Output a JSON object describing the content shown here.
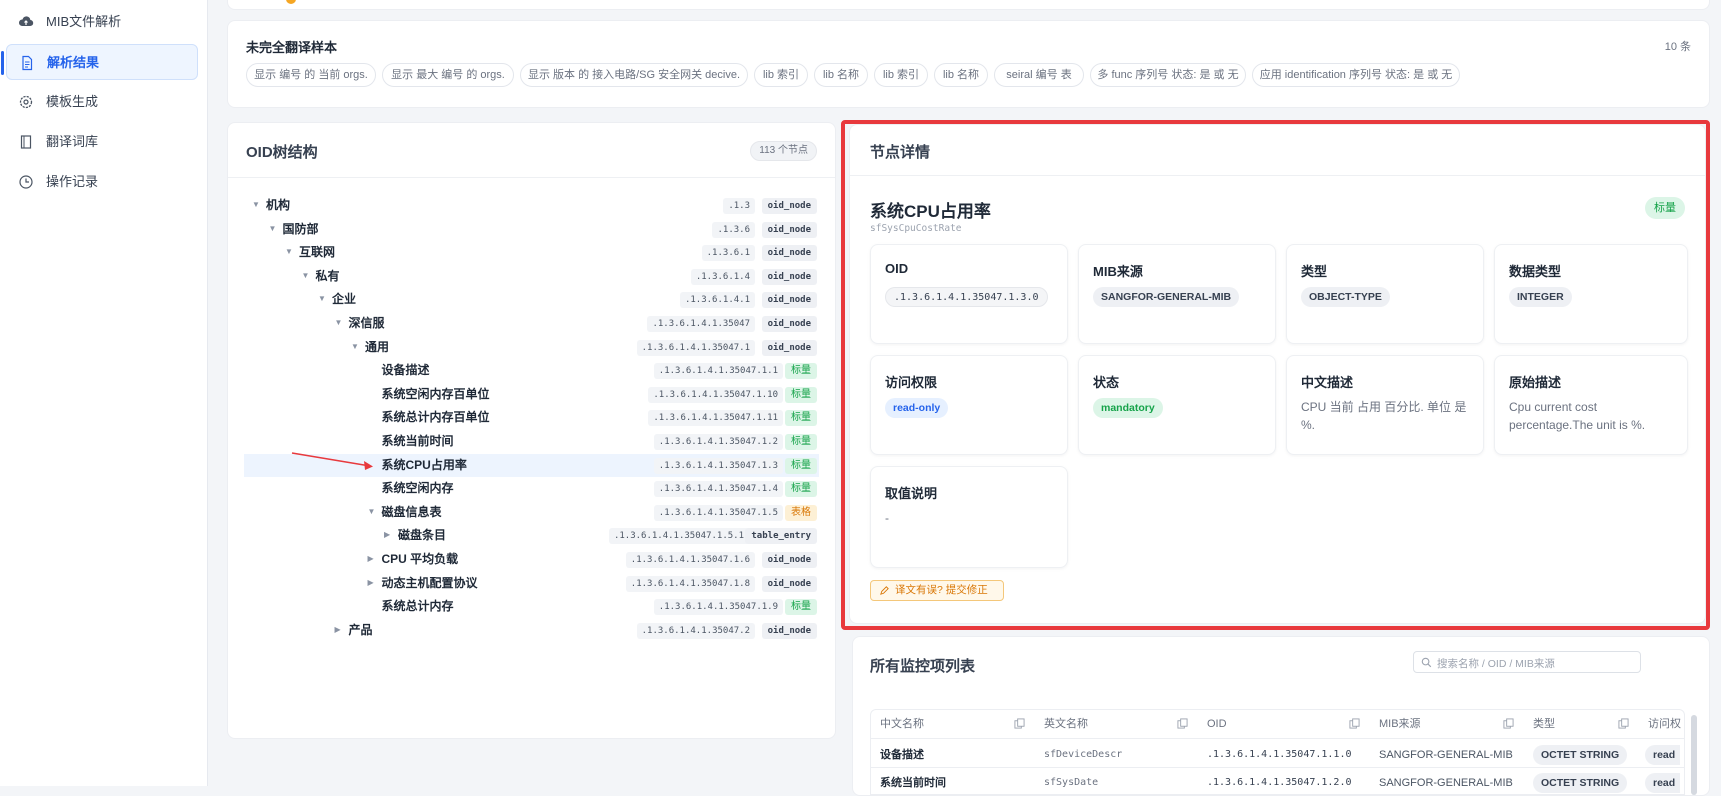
{
  "sidebar": {
    "items": [
      {
        "label": "MIB文件解析",
        "icon": "cloud-upload-icon"
      },
      {
        "label": "解析结果",
        "icon": "document-icon"
      },
      {
        "label": "模板生成",
        "icon": "gear-icon"
      },
      {
        "label": "翻译词库",
        "icon": "book-icon"
      },
      {
        "label": "操作记录",
        "icon": "clock-icon"
      }
    ]
  },
  "untranslated": {
    "title": "未完全翻译样本",
    "count": "10 条",
    "tags": [
      "显示 编号 的 当前 orgs.",
      "显示 最大 编号 的 orgs.",
      "显示 版本 的 接入电路/SG 安全网关 decive.",
      "lib 索引",
      "lib 名称",
      "lib 索引",
      "lib 名称",
      "seiral 编号 表",
      "多 func 序列号 状态: 是 或 无",
      "应用 identification 序列号 状态: 是 或 无"
    ]
  },
  "tree": {
    "title": "OID树结构",
    "node_count": "113 个节点",
    "rows": [
      {
        "label": "机构",
        "oid": ".1.3",
        "badge": "oid_node",
        "badge_type": "node",
        "caret": "down"
      },
      {
        "label": "国防部",
        "oid": ".1.3.6",
        "badge": "oid_node",
        "badge_type": "node",
        "caret": "down"
      },
      {
        "label": "互联网",
        "oid": ".1.3.6.1",
        "badge": "oid_node",
        "badge_type": "node",
        "caret": "down"
      },
      {
        "label": "私有",
        "oid": ".1.3.6.1.4",
        "badge": "oid_node",
        "badge_type": "node",
        "caret": "down"
      },
      {
        "label": "企业",
        "oid": ".1.3.6.1.4.1",
        "badge": "oid_node",
        "badge_type": "node",
        "caret": "down"
      },
      {
        "label": "深信服",
        "oid": ".1.3.6.1.4.1.35047",
        "badge": "oid_node",
        "badge_type": "node",
        "caret": "down"
      },
      {
        "label": "通用",
        "oid": ".1.3.6.1.4.1.35047.1",
        "badge": "oid_node",
        "badge_type": "node",
        "caret": "down"
      },
      {
        "label": "设备描述",
        "oid": ".1.3.6.1.4.1.35047.1.1",
        "badge": "标量",
        "badge_type": "scalar",
        "caret": ""
      },
      {
        "label": "系统空闲内存百单位",
        "oid": ".1.3.6.1.4.1.35047.1.10",
        "badge": "标量",
        "badge_type": "scalar",
        "caret": ""
      },
      {
        "label": "系统总计内存百单位",
        "oid": ".1.3.6.1.4.1.35047.1.11",
        "badge": "标量",
        "badge_type": "scalar",
        "caret": ""
      },
      {
        "label": "系统当前时间",
        "oid": ".1.3.6.1.4.1.35047.1.2",
        "badge": "标量",
        "badge_type": "scalar",
        "caret": ""
      },
      {
        "label": "系统CPU占用率",
        "oid": ".1.3.6.1.4.1.35047.1.3",
        "badge": "标量",
        "badge_type": "scalar",
        "caret": ""
      },
      {
        "label": "系统空闲内存",
        "oid": ".1.3.6.1.4.1.35047.1.4",
        "badge": "标量",
        "badge_type": "scalar",
        "caret": ""
      },
      {
        "label": "磁盘信息表",
        "oid": ".1.3.6.1.4.1.35047.1.5",
        "badge": "表格",
        "badge_type": "table",
        "caret": "down"
      },
      {
        "label": "磁盘条目",
        "oid": ".1.3.6.1.4.1.35047.1.5.1",
        "badge": "table_entry",
        "badge_type": "entry",
        "caret": "right"
      },
      {
        "label": "CPU 平均负载",
        "oid": ".1.3.6.1.4.1.35047.1.6",
        "badge": "oid_node",
        "badge_type": "node",
        "caret": "right"
      },
      {
        "label": "动态主机配置协议",
        "oid": ".1.3.6.1.4.1.35047.1.8",
        "badge": "oid_node",
        "badge_type": "node",
        "caret": "right"
      },
      {
        "label": "系统总计内存",
        "oid": ".1.3.6.1.4.1.35047.1.9",
        "badge": "标量",
        "badge_type": "scalar",
        "caret": ""
      },
      {
        "label": "产品",
        "oid": ".1.3.6.1.4.1.35047.2",
        "badge": "oid_node",
        "badge_type": "node",
        "caret": "right"
      }
    ]
  },
  "detail": {
    "title": "节点详情",
    "node_name": "系统CPU占用率",
    "node_symbol": "sfSysCpuCostRate",
    "kind_badge": "标量",
    "fields": {
      "oid": {
        "label": "OID",
        "value": ".1.3.6.1.4.1.35047.1.3.0"
      },
      "mib_source": {
        "label": "MIB来源",
        "value": "SANGFOR-GENERAL-MIB"
      },
      "type": {
        "label": "类型",
        "value": "OBJECT-TYPE"
      },
      "data_type": {
        "label": "数据类型",
        "value": "INTEGER"
      },
      "access": {
        "label": "访问权限",
        "value": "read-only"
      },
      "status": {
        "label": "状态",
        "value": "mandatory"
      },
      "cn_desc": {
        "label": "中文描述",
        "value": "CPU 当前 占用 百分比. 单位 是 %."
      },
      "orig_desc": {
        "label": "原始描述",
        "value": "Cpu current cost percentage.The unit is %."
      },
      "value_desc": {
        "label": "取值说明",
        "value": "-"
      }
    },
    "feedback_button": "译文有误? 提交修正"
  },
  "monitor_list": {
    "title": "所有监控项列表",
    "search_placeholder": "搜索名称 / OID / MIB来源",
    "columns": [
      "中文名称",
      "英文名称",
      "OID",
      "MIB来源",
      "类型",
      "访问权"
    ],
    "rows": [
      [
        "设备描述",
        "sfDeviceDescr",
        ".1.3.6.1.4.1.35047.1.1.0",
        "SANGFOR-GENERAL-MIB",
        "OCTET STRING",
        "read"
      ],
      [
        "系统当前时间",
        "sfSysDate",
        ".1.3.6.1.4.1.35047.1.2.0",
        "SANGFOR-GENERAL-MIB",
        "OCTET STRING",
        "read"
      ]
    ]
  },
  "colors": {
    "accent": "#2563eb",
    "highlight_border": "#e8393d",
    "scalar_green": "#16a34a",
    "table_orange": "#d97706"
  }
}
